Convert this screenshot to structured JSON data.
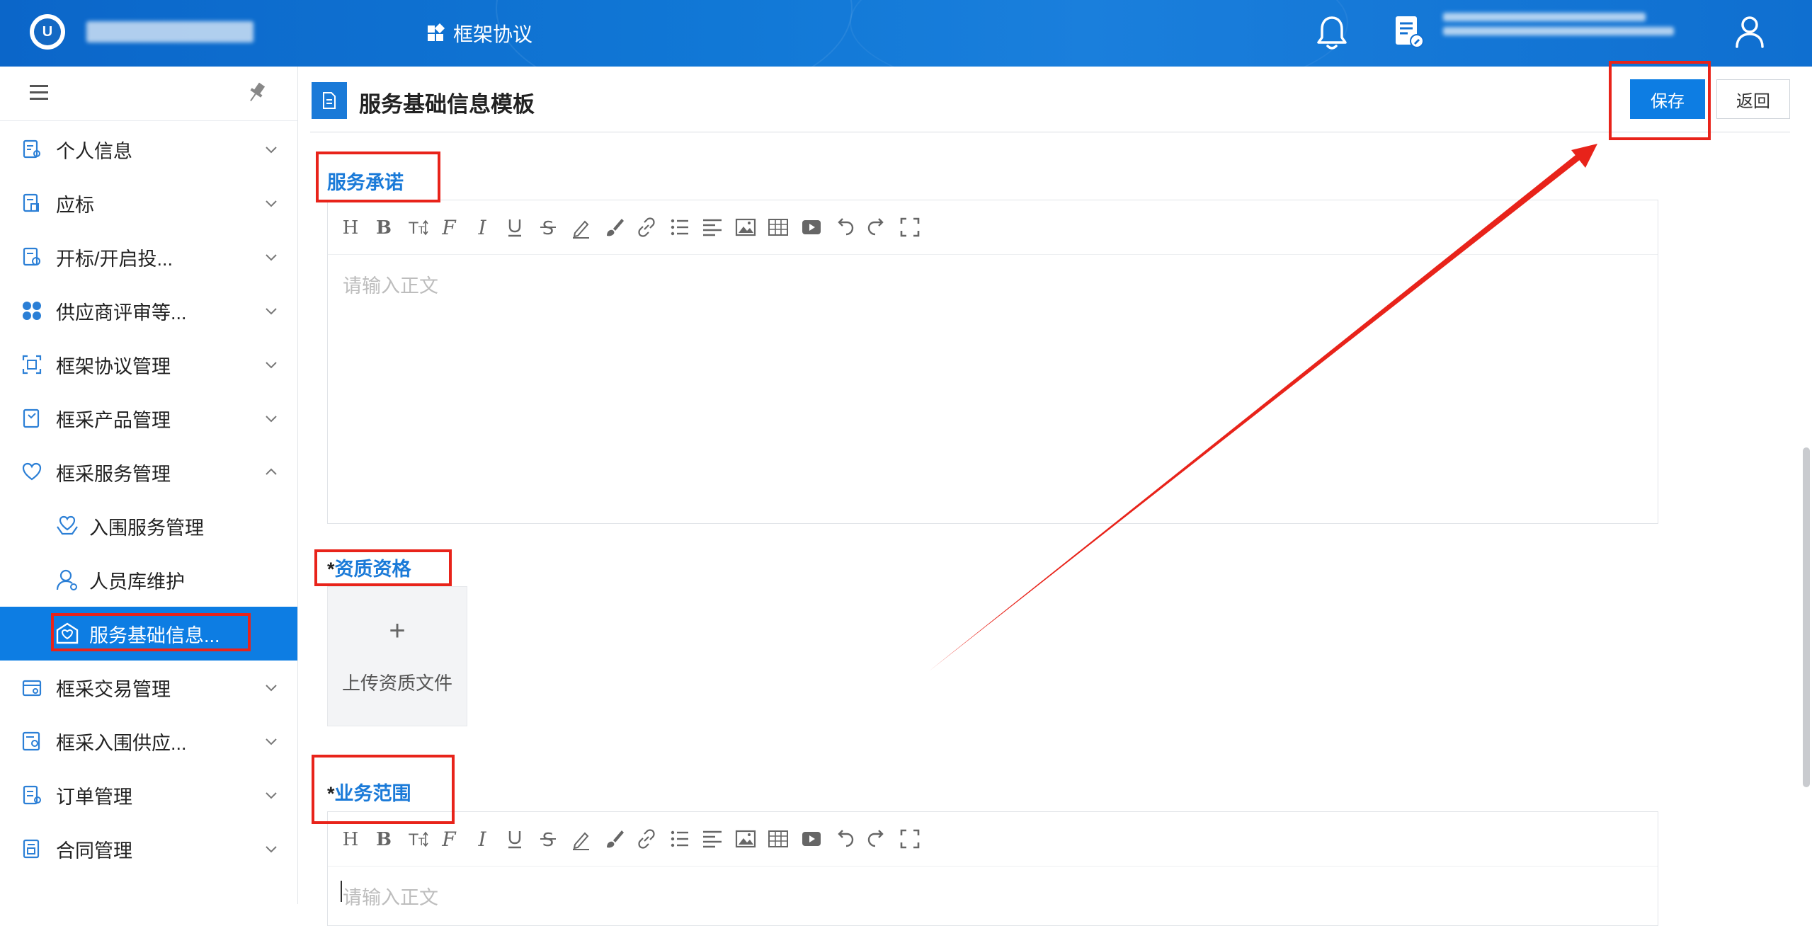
{
  "topbar": {
    "nav_label": "框架协议",
    "logo_letter": "U"
  },
  "sidebar": {
    "items": [
      {
        "label": "个人信息",
        "icon": "profile-doc-icon"
      },
      {
        "label": "应标",
        "icon": "bid-doc-icon"
      },
      {
        "label": "开标/开启投...",
        "icon": "open-bid-icon"
      },
      {
        "label": "供应商评审等...",
        "icon": "grid-clover-icon"
      },
      {
        "label": "框架协议管理",
        "icon": "frame-agreement-icon"
      },
      {
        "label": "框采产品管理",
        "icon": "product-icon"
      },
      {
        "label": "框采服务管理",
        "icon": "service-heart-icon"
      },
      {
        "label": "入围服务管理",
        "icon": "heart-hands-icon"
      },
      {
        "label": "人员库维护",
        "icon": "person-gear-icon"
      },
      {
        "label": "服务基础信息...",
        "icon": "service-info-icon"
      },
      {
        "label": "框采交易管理",
        "icon": "trade-icon"
      },
      {
        "label": "框采入围供应...",
        "icon": "supplier-icon"
      },
      {
        "label": "订单管理",
        "icon": "order-icon"
      },
      {
        "label": "合同管理",
        "icon": "contract-icon"
      }
    ]
  },
  "page": {
    "title": "服务基础信息模板",
    "save_label": "保存",
    "back_label": "返回"
  },
  "sections": {
    "commitment": {
      "label": "服务承诺",
      "placeholder": "请输入正文"
    },
    "qualification": {
      "required_mark": "*",
      "label": "资质资格",
      "upload_plus": "+",
      "upload_label": "上传资质文件"
    },
    "scope": {
      "required_mark": "*",
      "label": "业务范围",
      "placeholder": "请输入正文"
    }
  },
  "editor_toolbar": [
    "heading-icon",
    "bold-icon",
    "font-size-icon",
    "font-family-icon",
    "italic-icon",
    "underline-icon",
    "strikethrough-icon",
    "highlight-icon",
    "brush-icon",
    "link-icon",
    "list-icon",
    "align-left-icon",
    "image-icon",
    "table-icon",
    "video-icon",
    "undo-icon",
    "redo-icon",
    "fullscreen-icon"
  ],
  "colors": {
    "primary": "#0d7de3",
    "annotation_red": "#e8231a",
    "label_blue": "#1a7ad8"
  }
}
